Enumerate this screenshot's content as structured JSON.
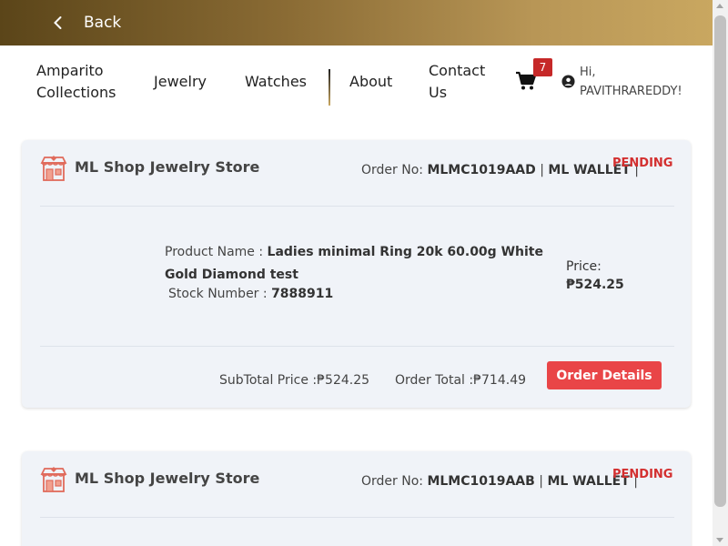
{
  "header": {
    "back_label": "Back"
  },
  "nav": {
    "collections": "Amparito Collections",
    "jewelry": "Jewelry",
    "watches": "Watches",
    "about": "About",
    "contact": "Contact Us",
    "cart_count": "7",
    "greeting": "Hi,",
    "username": "PAVITHRAREDDY!"
  },
  "orders": [
    {
      "store_name": "ML Shop Jewelry Store",
      "order_no_label": "Order No:",
      "order_no": "MLMC1019AAD",
      "payment": "ML WALLET",
      "status": "PENDING",
      "product_name_label": "Product Name :",
      "product_name": "Ladies minimal Ring 20k 60.00g White Gold Diamond test",
      "stock_label": "Stock Number :",
      "stock_number": "7888911",
      "price_label": "Price:",
      "price": "₱524.25",
      "subtotal_label": "SubTotal Price :",
      "subtotal": "₱524.25",
      "order_total_label": "Order Total :",
      "order_total": "₱714.49",
      "details_button": "Order Details"
    },
    {
      "store_name": "ML Shop Jewelry Store",
      "order_no_label": "Order No:",
      "order_no": "MLMC1019AAB",
      "payment": "ML WALLET",
      "status": "PENDING"
    }
  ],
  "colors": {
    "status": "#d32f2f",
    "button": "#e94547",
    "badge": "#c62828",
    "header_dark": "#5b4519",
    "header_light": "#c9a760"
  }
}
